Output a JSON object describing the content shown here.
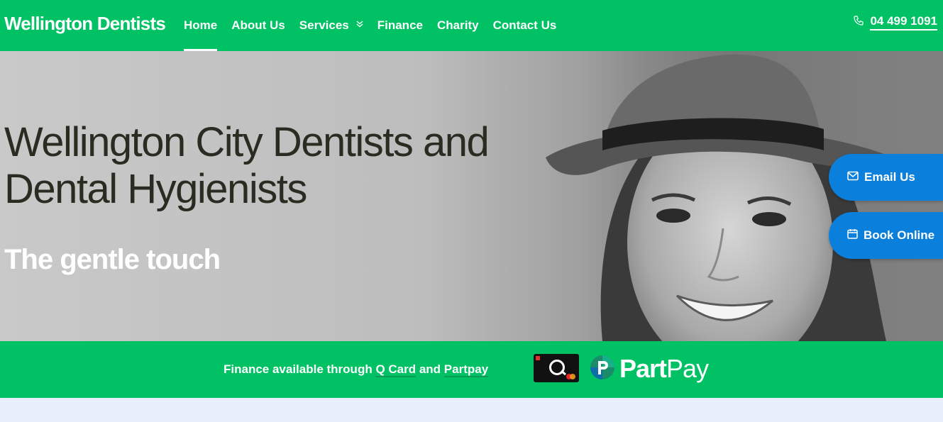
{
  "header": {
    "logo": "Wellington Dentists",
    "nav": [
      {
        "label": "Home"
      },
      {
        "label": "About Us"
      },
      {
        "label": "Services"
      },
      {
        "label": "Finance"
      },
      {
        "label": "Charity"
      },
      {
        "label": "Contact Us"
      }
    ],
    "phone": "04 499 1091"
  },
  "hero": {
    "title": "Wellington City Dentists and Dental Hygienists",
    "subtitle": "The gentle touch"
  },
  "side_buttons": {
    "email": "Email Us",
    "book": "Book Online"
  },
  "finance": {
    "text_before": "Finance available through ",
    "qcard_link": "Q Card",
    "text_middle": " and ",
    "partpay_link": "Partpay",
    "partpay_logo_part": "Part",
    "partpay_logo_pay": "Pay"
  },
  "colors": {
    "brand_green": "#00c164",
    "button_blue": "#0a7fdc",
    "page_bg": "#e9eefc"
  }
}
